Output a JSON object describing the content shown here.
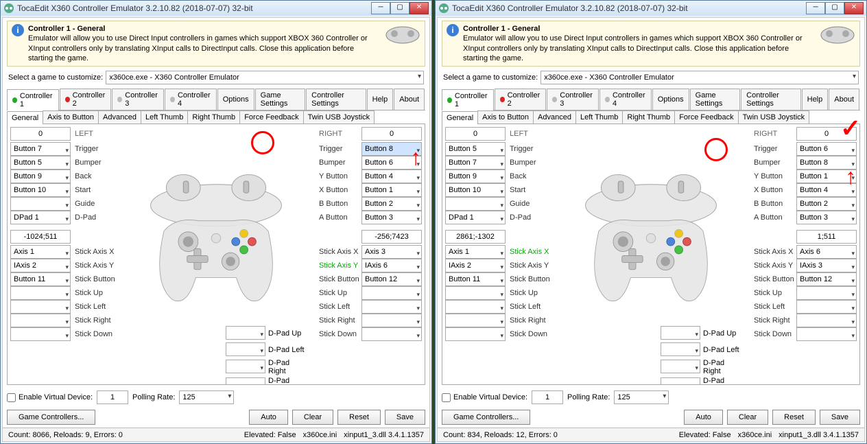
{
  "left": {
    "title": "TocaEdit X360 Controller Emulator 3.2.10.82 (2018-07-07) 32-bit",
    "banner_title": "Controller 1 - General",
    "banner_desc": "Emulator will allow you to use Direct Input controllers in games which support XBOX 360 Controller or XInput controllers only by translating XInput calls to DirectInput calls. Close this application before starting the game.",
    "select_game_lbl": "Select a game to customize:",
    "select_game_val": "x360ce.exe - X360 Controller Emulator",
    "main_tabs": [
      "Controller 1",
      "Controller 2",
      "Controller 3",
      "Controller 4",
      "Options",
      "Game Settings",
      "Controller Settings",
      "Help",
      "About"
    ],
    "sub_tabs": [
      "General",
      "Axis to Button",
      "Advanced",
      "Left Thumb",
      "Right Thumb",
      "Force Feedback",
      "Twin USB Joystick"
    ],
    "left_header_val": "0",
    "left_header_lbl": "LEFT",
    "right_header_lbl": "RIGHT",
    "right_header_val": "0",
    "left_rows": [
      {
        "dd": "Button 7",
        "lbl": "Trigger"
      },
      {
        "dd": "Button 5",
        "lbl": "Bumper"
      },
      {
        "dd": "Button 9",
        "lbl": "Back"
      },
      {
        "dd": "Button 10",
        "lbl": "Start"
      },
      {
        "dd": "",
        "lbl": "Guide"
      },
      {
        "dd": "DPad 1",
        "lbl": "D-Pad"
      }
    ],
    "left_num": "-1024;511",
    "left_rows2": [
      {
        "dd": "Axis 1",
        "lbl": "Stick Axis X"
      },
      {
        "dd": "IAxis 2",
        "lbl": "Stick Axis Y"
      },
      {
        "dd": "Button 11",
        "lbl": "Stick Button"
      },
      {
        "dd": "",
        "lbl": "Stick Up"
      },
      {
        "dd": "",
        "lbl": "Stick Left"
      },
      {
        "dd": "",
        "lbl": "Stick Right"
      },
      {
        "dd": "",
        "lbl": "Stick Down"
      }
    ],
    "right_rows": [
      {
        "lbl": "Trigger",
        "dd": "Button 8",
        "hi": true
      },
      {
        "lbl": "Bumper",
        "dd": "Button 6"
      },
      {
        "lbl": "Y Button",
        "dd": "Button 4"
      },
      {
        "lbl": "X Button",
        "dd": "Button 1"
      },
      {
        "lbl": "B Button",
        "dd": "Button 2"
      },
      {
        "lbl": "A Button",
        "dd": "Button 3"
      }
    ],
    "right_num": "-256;7423",
    "right_rows2": [
      {
        "lbl": "Stick Axis X",
        "dd": "Axis 3"
      },
      {
        "lbl": "Stick Axis Y",
        "dd": "IAxis 6",
        "green": true
      },
      {
        "lbl": "Stick Button",
        "dd": "Button 12"
      },
      {
        "lbl": "Stick Up",
        "dd": ""
      },
      {
        "lbl": "Stick Left",
        "dd": ""
      },
      {
        "lbl": "Stick Right",
        "dd": ""
      },
      {
        "lbl": "Stick Down",
        "dd": ""
      }
    ],
    "dpad_rows": [
      {
        "lbl": "D-Pad Up",
        "dd": ""
      },
      {
        "lbl": "D-Pad Left",
        "dd": ""
      },
      {
        "lbl": "D-Pad Right",
        "dd": ""
      },
      {
        "lbl": "D-Pad Down",
        "dd": ""
      }
    ],
    "evd_lbl": "Enable Virtual Device:",
    "evd_val": "1",
    "poll_lbl": "Polling Rate:",
    "poll_val": "125",
    "btn_gc": "Game Controllers...",
    "btn_auto": "Auto",
    "btn_clear": "Clear",
    "btn_reset": "Reset",
    "btn_save": "Save",
    "status_left": "Count: 8066, Reloads: 9, Errors: 0",
    "status_r1": "Elevated: False",
    "status_r2": "x360ce.ini",
    "status_r3": "xinput1_3.dll 3.4.1.1357"
  },
  "right": {
    "title": "TocaEdit X360 Controller Emulator 3.2.10.82 (2018-07-07) 32-bit",
    "banner_title": "Controller 1 - General",
    "banner_desc": "Emulator will allow you to use Direct Input controllers in games which support XBOX 360 Controller or XInput controllers only by translating XInput calls to DirectInput calls. Close this application before starting the game.",
    "select_game_lbl": "Select a game to customize:",
    "select_game_val": "x360ce.exe - X360 Controller Emulator",
    "main_tabs": [
      "Controller 1",
      "Controller 2",
      "Controller 3",
      "Controller 4",
      "Options",
      "Game Settings",
      "Controller Settings",
      "Help",
      "About"
    ],
    "sub_tabs": [
      "General",
      "Axis to Button",
      "Advanced",
      "Left Thumb",
      "Right Thumb",
      "Force Feedback",
      "Twin USB Joystick"
    ],
    "left_header_val": "0",
    "left_header_lbl": "LEFT",
    "right_header_lbl": "RIGHT",
    "right_header_val": "0",
    "left_rows": [
      {
        "dd": "Button 5",
        "lbl": "Trigger"
      },
      {
        "dd": "Button 7",
        "lbl": "Bumper"
      },
      {
        "dd": "Button 9",
        "lbl": "Back"
      },
      {
        "dd": "Button 10",
        "lbl": "Start"
      },
      {
        "dd": "",
        "lbl": "Guide"
      },
      {
        "dd": "DPad 1",
        "lbl": "D-Pad"
      }
    ],
    "left_num": "2861;-1302",
    "left_rows2": [
      {
        "dd": "Axis 1",
        "lbl": "Stick Axis X",
        "green": true
      },
      {
        "dd": "IAxis 2",
        "lbl": "Stick Axis Y"
      },
      {
        "dd": "Button 11",
        "lbl": "Stick Button"
      },
      {
        "dd": "",
        "lbl": "Stick Up"
      },
      {
        "dd": "",
        "lbl": "Stick Left"
      },
      {
        "dd": "",
        "lbl": "Stick Right"
      },
      {
        "dd": "",
        "lbl": "Stick Down"
      }
    ],
    "right_rows": [
      {
        "lbl": "Trigger",
        "dd": "Button 6"
      },
      {
        "lbl": "Bumper",
        "dd": "Button 8"
      },
      {
        "lbl": "Y Button",
        "dd": "Button 1"
      },
      {
        "lbl": "X Button",
        "dd": "Button 4"
      },
      {
        "lbl": "B Button",
        "dd": "Button 2"
      },
      {
        "lbl": "A Button",
        "dd": "Button 3"
      }
    ],
    "right_num": "1;511",
    "right_rows2": [
      {
        "lbl": "Stick Axis X",
        "dd": "Axis 6"
      },
      {
        "lbl": "Stick Axis Y",
        "dd": "IAxis 3"
      },
      {
        "lbl": "Stick Button",
        "dd": "Button 12"
      },
      {
        "lbl": "Stick Up",
        "dd": ""
      },
      {
        "lbl": "Stick Left",
        "dd": ""
      },
      {
        "lbl": "Stick Right",
        "dd": ""
      },
      {
        "lbl": "Stick Down",
        "dd": ""
      }
    ],
    "dpad_rows": [
      {
        "lbl": "D-Pad Up",
        "dd": ""
      },
      {
        "lbl": "D-Pad Left",
        "dd": ""
      },
      {
        "lbl": "D-Pad Right",
        "dd": ""
      },
      {
        "lbl": "D-Pad Down",
        "dd": ""
      }
    ],
    "evd_lbl": "Enable Virtual Device:",
    "evd_val": "1",
    "poll_lbl": "Polling Rate:",
    "poll_val": "125",
    "btn_gc": "Game Controllers...",
    "btn_auto": "Auto",
    "btn_clear": "Clear",
    "btn_reset": "Reset",
    "btn_save": "Save",
    "status_left": "Count: 834, Reloads: 12, Errors: 0",
    "status_r1": "Elevated: False",
    "status_r2": "x360ce.ini",
    "status_r3": "xinput1_3.dll 3.4.1.1357"
  }
}
